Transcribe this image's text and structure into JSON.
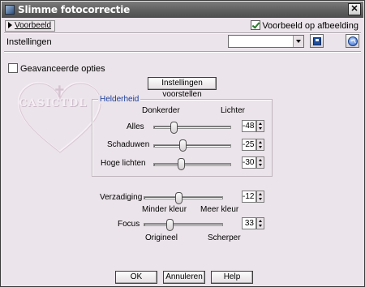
{
  "window": {
    "title": "Slimme fotocorrectie",
    "close_glyph": "✕"
  },
  "toolbar": {
    "preview_toggle": "Voorbeeld",
    "preview_on_image": "Voorbeeld op afbeelding",
    "preview_checked": true
  },
  "settings": {
    "label": "Instellingen",
    "selected_value": ""
  },
  "advanced": {
    "label": "Geavanceerde opties",
    "checked": false
  },
  "suggest_button": "Instellingen voorstellen",
  "watermark": {
    "text": "CASICTDL"
  },
  "brightness": {
    "title": "Helderheid",
    "left_label": "Donkerder",
    "right_label": "Lichter",
    "sliders": [
      {
        "label": "Alles",
        "value": "-48",
        "fraction": 0.26
      },
      {
        "label": "Schaduwen",
        "value": "-25",
        "fraction": 0.38
      },
      {
        "label": "Hoge lichten",
        "value": "-30",
        "fraction": 0.35
      }
    ]
  },
  "saturation": {
    "label": "Verzadiging",
    "value": "-12",
    "fraction": 0.44,
    "left_caption": "Minder kleur",
    "right_caption": "Meer kleur"
  },
  "focus": {
    "label": "Focus",
    "value": "33",
    "fraction": 0.33,
    "left_caption": "Origineel",
    "right_caption": "Scherper"
  },
  "buttons": {
    "ok": "OK",
    "cancel": "Annuleren",
    "help": "Help"
  },
  "colors": {
    "background": "#ebe4ea",
    "group_title": "#1a3c99"
  },
  "icons": [
    "app-icon",
    "close-icon",
    "triangle-right-icon",
    "save-icon",
    "reset-icon",
    "checkbox-icon"
  ]
}
